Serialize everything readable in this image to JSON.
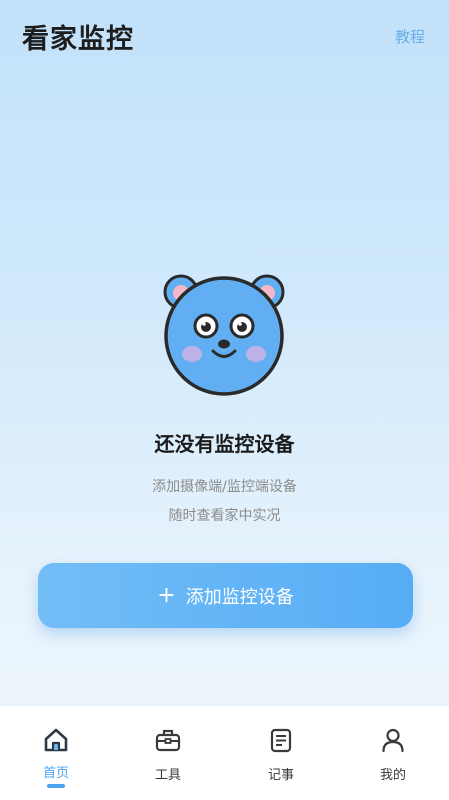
{
  "header": {
    "title": "看家监控",
    "tutorial_label": "教程"
  },
  "empty_state": {
    "title": "还没有监控设备",
    "description_line1": "添加摄像端/监控端设备",
    "description_line2": "随时查看家中实况",
    "illustration": "bear-face-icon"
  },
  "add_button": {
    "icon": "plus-icon",
    "label": "添加监控设备"
  },
  "tabbar": {
    "tabs": [
      {
        "label": "首页",
        "icon": "home-icon",
        "active": true
      },
      {
        "label": "工具",
        "icon": "toolbox-icon",
        "active": false
      },
      {
        "label": "记事",
        "icon": "notes-icon",
        "active": false
      },
      {
        "label": "我的",
        "icon": "profile-icon",
        "active": false
      }
    ]
  },
  "colors": {
    "accent": "#4aa4ee",
    "button_gradient_start": "#72bdf6",
    "button_gradient_end": "#56adf5",
    "bear_fill": "#62aef2"
  }
}
